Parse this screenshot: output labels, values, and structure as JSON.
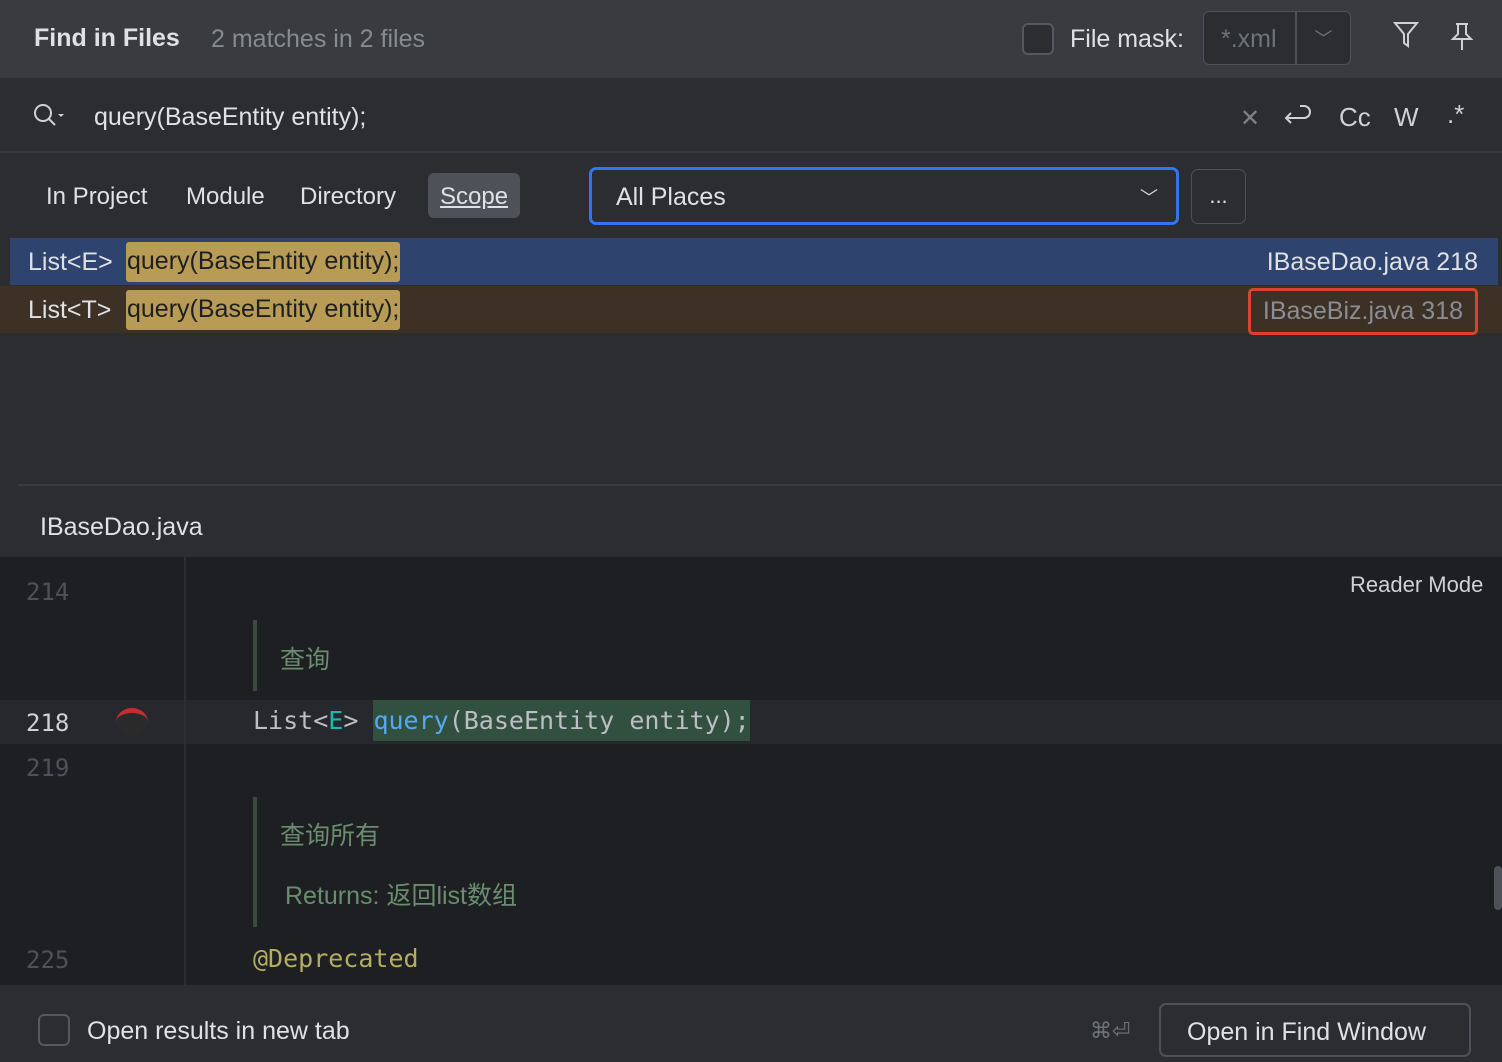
{
  "header": {
    "title": "Find in Files",
    "match_count": "2 matches in 2 files",
    "file_mask_label": "File mask:",
    "file_mask_value": "*.xml"
  },
  "search": {
    "query": "query(BaseEntity entity);",
    "toggles": [
      "Cc",
      "W",
      ".*"
    ]
  },
  "scopes": [
    {
      "label": "In Project"
    },
    {
      "label": "Module"
    },
    {
      "label": "Directory"
    },
    {
      "label": "Scope",
      "selected": true
    }
  ],
  "scope_value": "All Places",
  "more_label": "...",
  "results": [
    {
      "prefix": "List<E>",
      "match": "query(BaseEntity entity);",
      "file": "IBaseDao.java 218",
      "selected": true
    },
    {
      "prefix": "List<T>",
      "match": "query(BaseEntity entity);",
      "file": "IBaseBiz.java 318",
      "highlighted": true
    }
  ],
  "preview": {
    "file_name": "IBaseDao.java",
    "reader_mode": "Reader Mode",
    "lines": {
      "l214": "214",
      "l218": "218",
      "l219": "219",
      "l225": "225"
    },
    "doc1": "查询",
    "code_prefix": "List<",
    "code_type": "E",
    "code_gt": "> ",
    "code_method": "query",
    "code_rest": "(BaseEntity entity);",
    "doc2": "查询所有",
    "returns_label": "Returns:",
    "returns_text": "返回list数组",
    "annotation": "@Deprecated"
  },
  "footer": {
    "new_tab_label": "Open results in new tab",
    "shortcut": "⌘⏎",
    "open_button": "Open in Find Window"
  },
  "colors": {
    "accent": "#3574f0",
    "match": "#b89b54",
    "highlight_border": "#e0412d"
  }
}
